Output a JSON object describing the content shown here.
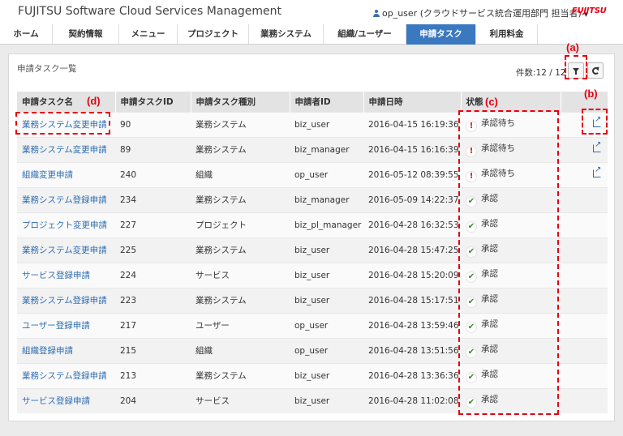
{
  "header": {
    "title": "FUJITSU Software Cloud Services Management",
    "user": "op_user (クラウドサービス統合運用部門 担当者)",
    "brand": "FUJITSU"
  },
  "nav": [
    {
      "label": "ホーム"
    },
    {
      "label": "契約情報"
    },
    {
      "label": "メニュー"
    },
    {
      "label": "プロジェクト"
    },
    {
      "label": "業務システム"
    },
    {
      "label": "組織/ユーザー"
    },
    {
      "label": "申請タスク",
      "active": true
    },
    {
      "label": "利用料金"
    }
  ],
  "panel": {
    "title": "申請タスク一覧",
    "count": "件数:12 / 12"
  },
  "table": {
    "headers": [
      "申請タスク名",
      "申請タスクID",
      "申請タスク種別",
      "申請者ID",
      "申請日時",
      "状態"
    ],
    "rows": [
      [
        "業務システム変更申請",
        "90",
        "業務システム",
        "biz_user",
        "2016-04-15 16:19:36",
        "承認待ち"
      ],
      [
        "業務システム変更申請",
        "89",
        "業務システム",
        "biz_manager",
        "2016-04-15 16:16:39",
        "承認待ち"
      ],
      [
        "組織変更申請",
        "240",
        "組織",
        "op_user",
        "2016-05-12 08:39:55",
        "承認待ち"
      ],
      [
        "業務システム登録申請",
        "234",
        "業務システム",
        "biz_manager",
        "2016-05-09 14:22:37",
        "承認"
      ],
      [
        "プロジェクト変更申請",
        "227",
        "プロジェクト",
        "biz_pl_manager",
        "2016-04-28 16:32:53",
        "承認"
      ],
      [
        "業務システム変更申請",
        "225",
        "業務システム",
        "biz_user",
        "2016-04-28 15:47:25",
        "承認"
      ],
      [
        "サービス登録申請",
        "224",
        "サービス",
        "biz_user",
        "2016-04-28 15:20:09",
        "承認"
      ],
      [
        "業務システム登録申請",
        "223",
        "業務システム",
        "biz_user",
        "2016-04-28 15:17:51",
        "承認"
      ],
      [
        "ユーザー登録申請",
        "217",
        "ユーザー",
        "op_user",
        "2016-04-28 13:59:46",
        "承認"
      ],
      [
        "組織登録申請",
        "215",
        "組織",
        "op_user",
        "2016-04-28 13:51:56",
        "承認"
      ],
      [
        "業務システム登録申請",
        "213",
        "業務システム",
        "biz_user",
        "2016-04-28 13:36:36",
        "承認"
      ],
      [
        "サービス登録申請",
        "204",
        "サービス",
        "biz_user",
        "2016-04-28 11:02:08",
        "承認"
      ]
    ]
  },
  "icons": {
    "pending": "exclamation-icon",
    "approved": "check-icon",
    "external": "external-link-icon"
  },
  "colors": {
    "nav_active": "#3a78c0",
    "link": "#2f6db0",
    "callout": "#e60012",
    "pending": "#d42020",
    "approved": "#3a8a2a"
  },
  "annotations": {
    "a": "(a)",
    "b": "(b)",
    "c": "(c)",
    "d": "(d)"
  }
}
